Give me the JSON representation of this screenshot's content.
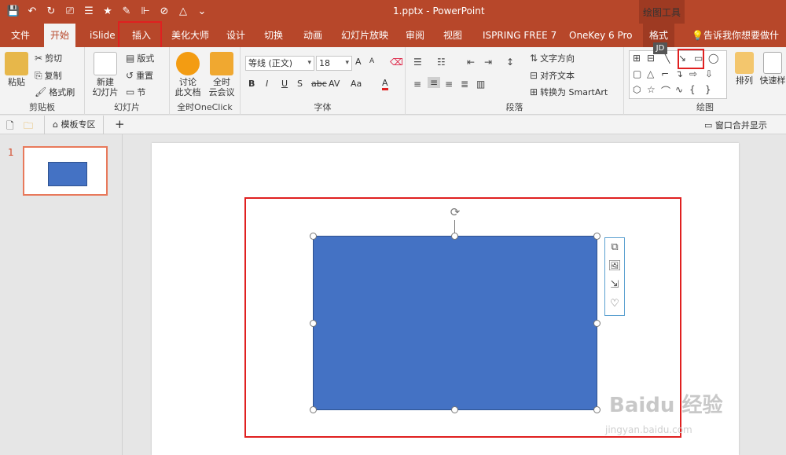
{
  "window": {
    "title": "1.pptx - PowerPoint",
    "context_tab_title": "绘图工具"
  },
  "tabs": [
    {
      "label": "文件"
    },
    {
      "label": "开始"
    },
    {
      "label": "iSlide"
    },
    {
      "label": "插入"
    },
    {
      "label": "美化大师"
    },
    {
      "label": "设计"
    },
    {
      "label": "切换"
    },
    {
      "label": "动画"
    },
    {
      "label": "幻灯片放映"
    },
    {
      "label": "审阅"
    },
    {
      "label": "视图"
    },
    {
      "label": "ISPRING FREE 7"
    },
    {
      "label": "OneKey 6 Pro"
    },
    {
      "label": "格式"
    }
  ],
  "tell_me": "告诉我你想要做什么",
  "badge": "JD",
  "clipboard": {
    "paste": "粘贴",
    "cut": "剪切",
    "copy": "复制",
    "painter": "格式刷",
    "label": "剪贴板"
  },
  "slides_group": {
    "new": "新建",
    "new2": "幻灯片",
    "layout": "版式",
    "reset": "重置",
    "section": "节",
    "label": "幻灯片"
  },
  "oneclick": {
    "discuss": "讨论",
    "discuss2": "此文档",
    "meet": "全时",
    "meet2": "云会议",
    "label": "全时OneClick"
  },
  "font": {
    "name": "等线 (正文)",
    "size": "18",
    "label": "字体",
    "grow": "A",
    "shrink": "A",
    "bold": "B",
    "italic": "I",
    "underline": "U",
    "shadow": "S",
    "strike": "abc",
    "spacing": "AV",
    "case": "Aa",
    "color": "A"
  },
  "paragraph": {
    "text_dir": "文字方向",
    "align_text": "对齐文本",
    "smartart": "转换为 SmartArt",
    "label": "段落"
  },
  "drawing": {
    "arrange": "排列",
    "quick_style": "快速样",
    "label": "绘图"
  },
  "subbar": {
    "template_zone": "模板专区",
    "plus": "+",
    "merge": "窗口合并显示"
  },
  "thumbnails": [
    {
      "number": "1"
    }
  ],
  "watermark": {
    "brand": "Baidu 经验",
    "url": "jingyan.baidu.com"
  }
}
